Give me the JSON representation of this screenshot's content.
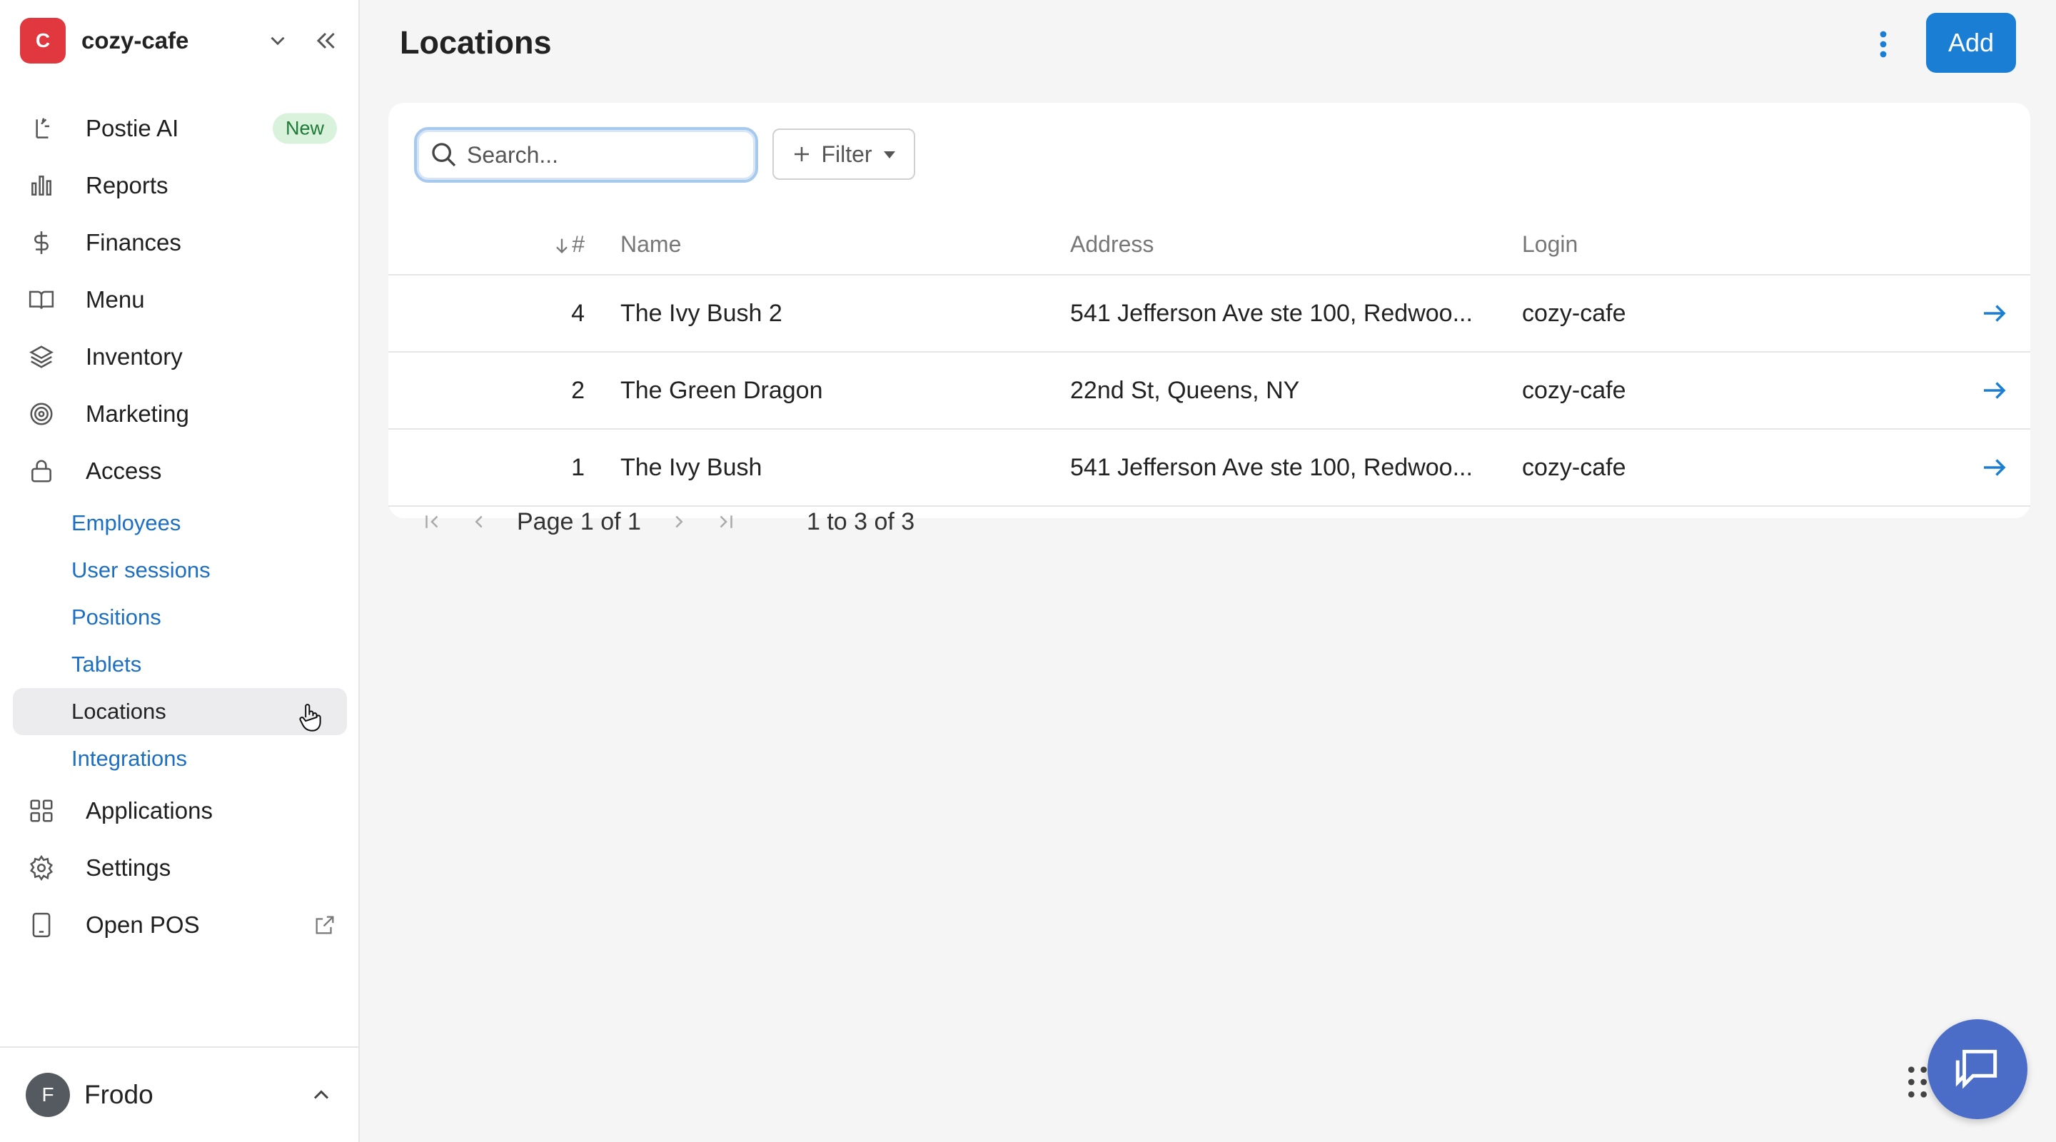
{
  "org": {
    "initial": "C",
    "name": "cozy-cafe",
    "avatar_color": "#e0383e"
  },
  "nav": {
    "items": [
      {
        "label": "Postie AI",
        "icon": "wand-icon",
        "badge": "New"
      },
      {
        "label": "Reports",
        "icon": "bar-chart-icon"
      },
      {
        "label": "Finances",
        "icon": "dollar-icon"
      },
      {
        "label": "Menu",
        "icon": "book-icon"
      },
      {
        "label": "Inventory",
        "icon": "layers-icon"
      },
      {
        "label": "Marketing",
        "icon": "target-icon"
      },
      {
        "label": "Access",
        "icon": "lock-icon"
      }
    ],
    "access_sub": [
      {
        "label": "Employees"
      },
      {
        "label": "User sessions"
      },
      {
        "label": "Positions"
      },
      {
        "label": "Tablets"
      },
      {
        "label": "Locations",
        "active": true
      },
      {
        "label": "Integrations"
      }
    ],
    "bottom_items": [
      {
        "label": "Applications",
        "icon": "grid-icon"
      },
      {
        "label": "Settings",
        "icon": "gear-icon"
      },
      {
        "label": "Open POS",
        "icon": "tablet-icon"
      }
    ]
  },
  "user": {
    "initial": "F",
    "name": "Frodo"
  },
  "header": {
    "title": "Locations",
    "add_label": "Add"
  },
  "search": {
    "placeholder": "Search..."
  },
  "filter": {
    "label": "Filter"
  },
  "table": {
    "columns": {
      "num": "#",
      "name": "Name",
      "address": "Address",
      "login": "Login"
    },
    "rows": [
      {
        "num": "4",
        "name": "The Ivy Bush 2",
        "address": "541 Jefferson Ave ste 100, Redwoo...",
        "login": "cozy-cafe"
      },
      {
        "num": "2",
        "name": "The Green Dragon",
        "address": "22nd St, Queens, NY",
        "login": "cozy-cafe"
      },
      {
        "num": "1",
        "name": "The Ivy Bush",
        "address": "541 Jefferson Ave ste 100, Redwoo...",
        "login": "cozy-cafe"
      }
    ]
  },
  "pager": {
    "page_label": "Page",
    "page": "1",
    "of_label": "of",
    "total_pages": "1",
    "range": "1 to 3 of 3"
  },
  "colors": {
    "accent": "#1a7fd4",
    "link": "#1d6fc4",
    "chat": "#4b6cc7"
  }
}
